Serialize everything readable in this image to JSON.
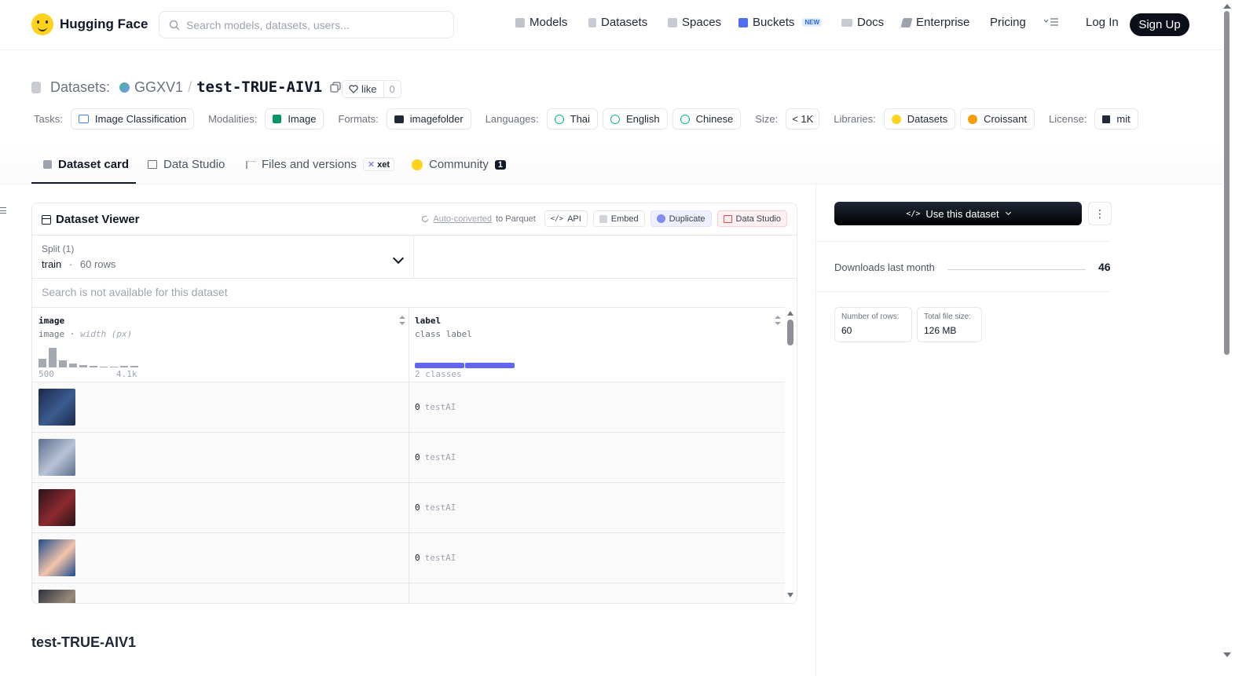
{
  "header": {
    "logo_text": "Hugging Face",
    "search_placeholder": "Search models, datasets, users...",
    "nav": [
      {
        "label": "Models"
      },
      {
        "label": "Datasets"
      },
      {
        "label": "Spaces"
      },
      {
        "label": "Buckets",
        "badge": "NEW"
      },
      {
        "label": "Docs"
      },
      {
        "label": "Enterprise"
      },
      {
        "label": "Pricing"
      }
    ],
    "login": "Log In",
    "signup": "Sign Up"
  },
  "repo": {
    "type_label": "Datasets:",
    "org": "GGXV1",
    "slash": "/",
    "name": "test-TRUE-AIV1",
    "like_label": "like",
    "like_count": "0"
  },
  "tags": {
    "tasks_label": "Tasks:",
    "task": "Image Classification",
    "modalities_label": "Modalities:",
    "modality": "Image",
    "formats_label": "Formats:",
    "format": "imagefolder",
    "languages_label": "Languages:",
    "languages": [
      "Thai",
      "English",
      "Chinese"
    ],
    "size_label": "Size:",
    "size": "< 1K",
    "libraries_label": "Libraries:",
    "libraries": [
      "Datasets",
      "Croissant"
    ],
    "license_label": "License:",
    "license": "mit"
  },
  "tabs": {
    "card": "Dataset card",
    "studio": "Data Studio",
    "files": "Files and versions",
    "xet": "xet",
    "community": "Community",
    "community_count": "1"
  },
  "viewer": {
    "title": "Dataset Viewer",
    "auto_converted": "Auto-converted",
    "to_parquet": "to Parquet",
    "api": "API",
    "embed": "Embed",
    "duplicate": "Duplicate",
    "data_studio": "Data Studio",
    "split_label": "Split (1)",
    "split_name": "train",
    "split_sep": "·",
    "split_rows": "60 rows",
    "search_na": "Search is not available for this dataset",
    "columns": [
      {
        "name": "image",
        "type": "image",
        "subtype": "width (px)",
        "min": "500",
        "max": "4.1k"
      },
      {
        "name": "label",
        "type": "class label",
        "classes": "2 classes"
      }
    ],
    "histogram": [
      0.45,
      1.0,
      0.36,
      0.2,
      0.1,
      0.06,
      0.0,
      0.0,
      0.06,
      0.06
    ],
    "class_shares": [
      0.5,
      0.5
    ],
    "rows": [
      {
        "label_id": "0",
        "label_name": "testAI",
        "thumb": [
          "#1c2a4a",
          "#3b5b8f"
        ]
      },
      {
        "label_id": "0",
        "label_name": "testAI",
        "thumb": [
          "#5c6f8f",
          "#b8c3d6"
        ]
      },
      {
        "label_id": "0",
        "label_name": "testAI",
        "thumb": [
          "#2b1418",
          "#8a2a2f"
        ]
      },
      {
        "label_id": "0",
        "label_name": "testAI",
        "thumb": [
          "#1d4b8f",
          "#f2c4a8"
        ]
      },
      {
        "label_id": "",
        "label_name": "",
        "thumb": [
          "#2d3140",
          "#9a8a7a"
        ]
      }
    ]
  },
  "card_title": "test-TRUE-AIV1",
  "sidebar": {
    "use_button": "Use this dataset",
    "downloads_label": "Downloads last month",
    "downloads_value": "46",
    "rows_label": "Number of rows:",
    "rows_value": "60",
    "size_label": "Total file size:",
    "size_value": "126 MB"
  }
}
